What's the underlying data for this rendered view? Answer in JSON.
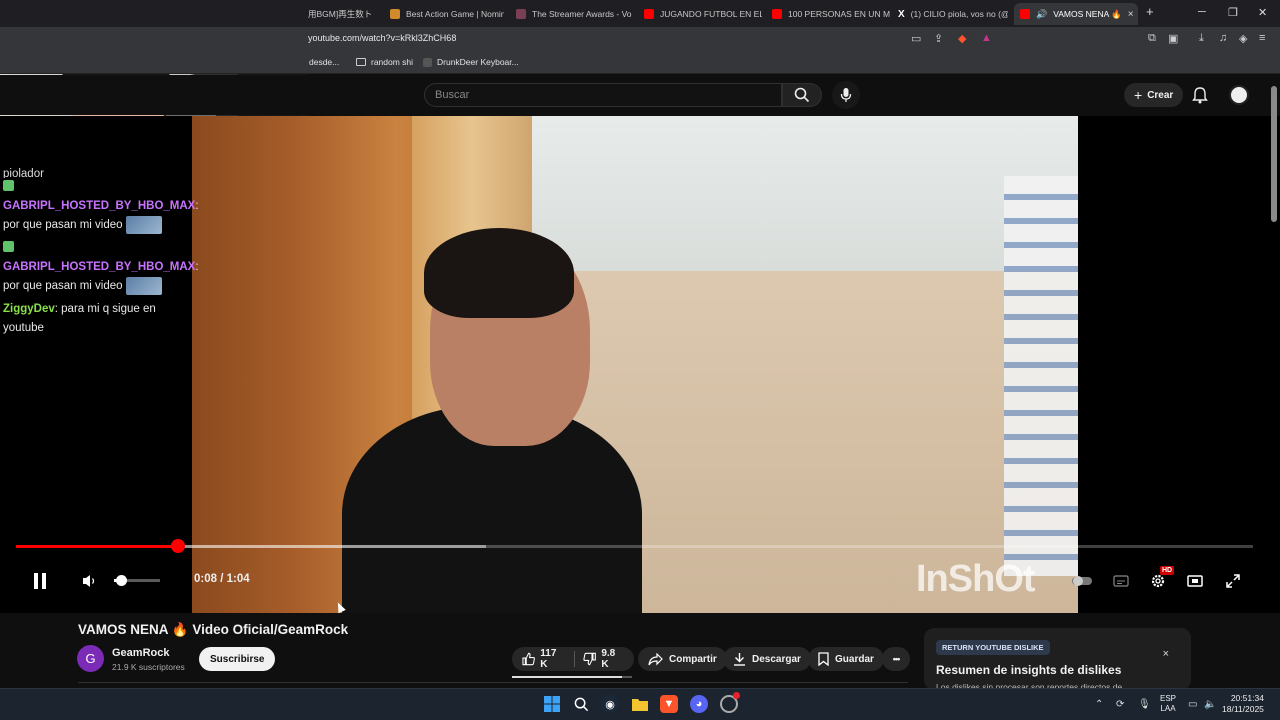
{
  "browser": {
    "tabs": [
      {
        "label": "用BGM]再生数ト",
        "favicon_color": "#444"
      },
      {
        "label": "Best Action Game | Nomin",
        "favicon_color": "#d08a2b"
      },
      {
        "label": "The Streamer Awards - Vo",
        "favicon_color": "#7a3f55"
      },
      {
        "label": "JUGANDO FUTBOL EN EL",
        "favicon_color": "#ff0000"
      },
      {
        "label": "100 PERSONAS EN UN M",
        "favicon_color": "#ff0000"
      },
      {
        "label": "(1) CILIO piola, vos no (@",
        "favicon_color": "#000000"
      },
      {
        "label": "VAMOS NENA 🔥",
        "favicon_color": "#ff0000"
      }
    ],
    "url": "youtube.com/watch?v=kRkl3ZhCH68",
    "bookmarks": [
      {
        "label": "desde..."
      },
      {
        "label": "random shi"
      },
      {
        "label": "DrunkDeer Keyboar..."
      }
    ],
    "new_tab": "+",
    "close_tab": "×",
    "win_min": "─",
    "win_max": "❐",
    "win_close": "✕"
  },
  "youtube": {
    "search_placeholder": "Buscar",
    "create_label": "Crear",
    "create_plus": "+"
  },
  "chat": {
    "clipped_line": "piolador",
    "messages": [
      {
        "user": "GABRIPL_HOSTED_BY_HBO_MAX",
        "text": "por que pasan mi video",
        "color": "#c873ff",
        "emote": true
      },
      {
        "user": "GABRIPL_HOSTED_BY_HBO_MAX",
        "text": "por que pasan mi video",
        "color": "#c873ff",
        "emote": true
      },
      {
        "user": "ZiggyDev",
        "text": "para mi q sigue en youtube",
        "color": "#8be04c",
        "emote": false
      }
    ]
  },
  "player": {
    "time": "0:08 / 1:04",
    "progress_fraction": 0.131,
    "buffered_fraction": 0.38,
    "volume_fraction": 0.15,
    "hd_badge": "HD",
    "watermark": "InShOt"
  },
  "video_info": {
    "title": "VAMOS NENA 🔥 Video Oficial/GeamRock",
    "channel": "GeamRock",
    "channel_initial": "G",
    "subscribers": "21.9 K suscriptores",
    "subscribe_label": "Suscribirse",
    "likes": "117 K",
    "dislikes": "9.8 K",
    "share_label": "Compartir",
    "download_label": "Descargar",
    "save_label": "Guardar",
    "more_label": "•••",
    "like_ratio": 0.92
  },
  "ryd": {
    "tag": "RETURN YOUTUBE DISLIKE",
    "title": "Resumen de insights de dislikes",
    "subtitle": "Los dislikes sin procesar son reportes directos de",
    "close": "×"
  },
  "taskbar": {
    "lang_top": "ESP",
    "lang_bottom": "LAA",
    "time": "20:51:34",
    "date": "18/11/2025"
  }
}
